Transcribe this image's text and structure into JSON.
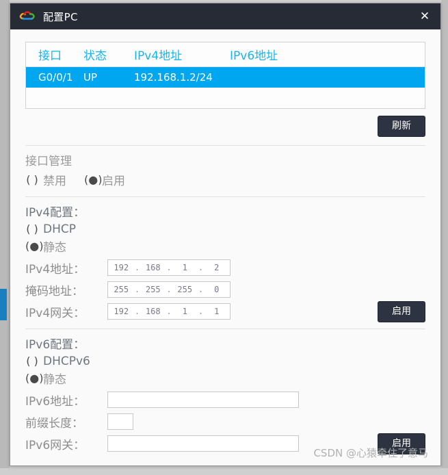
{
  "window": {
    "title": "配置PC",
    "logo_icon": "cloud-logo-icon",
    "close_icon": "✕"
  },
  "interface_table": {
    "columns": [
      "接口",
      "状态",
      "IPv4地址",
      "IPv6地址"
    ],
    "rows": [
      {
        "interface": "G0/0/1",
        "state": "UP",
        "ipv4": "192.168.1.2/24",
        "ipv6": ""
      }
    ],
    "refresh_label": "刷新",
    "highlight_color": "#00a7f0",
    "header_color": "#13b5f5"
  },
  "interface_mgmt": {
    "title": "接口管理",
    "options": [
      {
        "label": "禁用",
        "glyph": "(  )",
        "selected": false
      },
      {
        "label": "启用",
        "glyph": "(●)",
        "selected": true
      }
    ]
  },
  "ipv4": {
    "title": "IPv4配置：",
    "mode_options": [
      {
        "label": "DHCP",
        "glyph": "(  )",
        "selected": false
      },
      {
        "label": "静态",
        "glyph": "(●)",
        "selected": true
      }
    ],
    "address_label": "IPv4地址：",
    "address": [
      "192",
      "168",
      "1",
      "2"
    ],
    "mask_label": "掩码地址：",
    "mask": [
      "255",
      "255",
      "255",
      "0"
    ],
    "gateway_label": "IPv4网关：",
    "gateway": [
      "192",
      "168",
      "1",
      "1"
    ],
    "apply_label": "启用"
  },
  "ipv6": {
    "title": "IPv6配置：",
    "mode_options": [
      {
        "label": "DHCPv6",
        "glyph": "(  )",
        "selected": false
      },
      {
        "label": "静态",
        "glyph": "(●)",
        "selected": true
      }
    ],
    "address_label": "IPv6地址：",
    "address": "",
    "prefix_label": "前缀长度：",
    "prefix": "",
    "gateway_label": "IPv6网关：",
    "gateway": "",
    "apply_label": "启用"
  },
  "watermark": "CSDN @心猿牵住了意马"
}
